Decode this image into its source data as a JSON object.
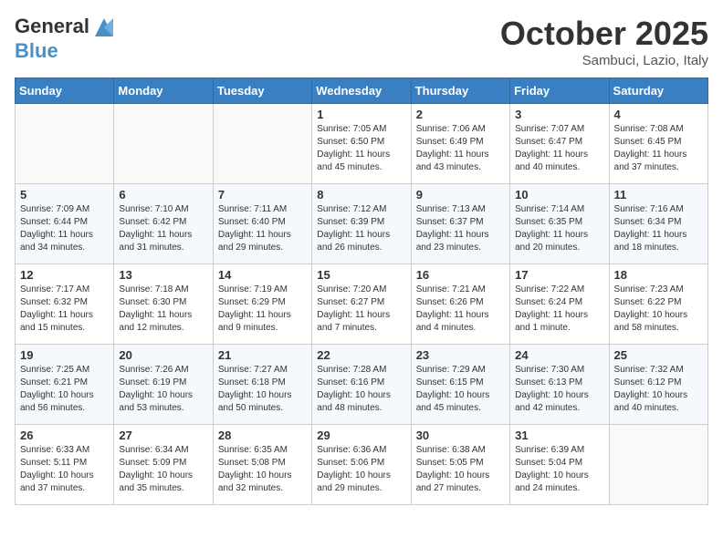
{
  "header": {
    "logo_line1": "General",
    "logo_line2": "Blue",
    "month": "October 2025",
    "location": "Sambuci, Lazio, Italy"
  },
  "weekdays": [
    "Sunday",
    "Monday",
    "Tuesday",
    "Wednesday",
    "Thursday",
    "Friday",
    "Saturday"
  ],
  "weeks": [
    [
      {
        "day": "",
        "info": ""
      },
      {
        "day": "",
        "info": ""
      },
      {
        "day": "",
        "info": ""
      },
      {
        "day": "1",
        "info": "Sunrise: 7:05 AM\nSunset: 6:50 PM\nDaylight: 11 hours\nand 45 minutes."
      },
      {
        "day": "2",
        "info": "Sunrise: 7:06 AM\nSunset: 6:49 PM\nDaylight: 11 hours\nand 43 minutes."
      },
      {
        "day": "3",
        "info": "Sunrise: 7:07 AM\nSunset: 6:47 PM\nDaylight: 11 hours\nand 40 minutes."
      },
      {
        "day": "4",
        "info": "Sunrise: 7:08 AM\nSunset: 6:45 PM\nDaylight: 11 hours\nand 37 minutes."
      }
    ],
    [
      {
        "day": "5",
        "info": "Sunrise: 7:09 AM\nSunset: 6:44 PM\nDaylight: 11 hours\nand 34 minutes."
      },
      {
        "day": "6",
        "info": "Sunrise: 7:10 AM\nSunset: 6:42 PM\nDaylight: 11 hours\nand 31 minutes."
      },
      {
        "day": "7",
        "info": "Sunrise: 7:11 AM\nSunset: 6:40 PM\nDaylight: 11 hours\nand 29 minutes."
      },
      {
        "day": "8",
        "info": "Sunrise: 7:12 AM\nSunset: 6:39 PM\nDaylight: 11 hours\nand 26 minutes."
      },
      {
        "day": "9",
        "info": "Sunrise: 7:13 AM\nSunset: 6:37 PM\nDaylight: 11 hours\nand 23 minutes."
      },
      {
        "day": "10",
        "info": "Sunrise: 7:14 AM\nSunset: 6:35 PM\nDaylight: 11 hours\nand 20 minutes."
      },
      {
        "day": "11",
        "info": "Sunrise: 7:16 AM\nSunset: 6:34 PM\nDaylight: 11 hours\nand 18 minutes."
      }
    ],
    [
      {
        "day": "12",
        "info": "Sunrise: 7:17 AM\nSunset: 6:32 PM\nDaylight: 11 hours\nand 15 minutes."
      },
      {
        "day": "13",
        "info": "Sunrise: 7:18 AM\nSunset: 6:30 PM\nDaylight: 11 hours\nand 12 minutes."
      },
      {
        "day": "14",
        "info": "Sunrise: 7:19 AM\nSunset: 6:29 PM\nDaylight: 11 hours\nand 9 minutes."
      },
      {
        "day": "15",
        "info": "Sunrise: 7:20 AM\nSunset: 6:27 PM\nDaylight: 11 hours\nand 7 minutes."
      },
      {
        "day": "16",
        "info": "Sunrise: 7:21 AM\nSunset: 6:26 PM\nDaylight: 11 hours\nand 4 minutes."
      },
      {
        "day": "17",
        "info": "Sunrise: 7:22 AM\nSunset: 6:24 PM\nDaylight: 11 hours\nand 1 minute."
      },
      {
        "day": "18",
        "info": "Sunrise: 7:23 AM\nSunset: 6:22 PM\nDaylight: 10 hours\nand 58 minutes."
      }
    ],
    [
      {
        "day": "19",
        "info": "Sunrise: 7:25 AM\nSunset: 6:21 PM\nDaylight: 10 hours\nand 56 minutes."
      },
      {
        "day": "20",
        "info": "Sunrise: 7:26 AM\nSunset: 6:19 PM\nDaylight: 10 hours\nand 53 minutes."
      },
      {
        "day": "21",
        "info": "Sunrise: 7:27 AM\nSunset: 6:18 PM\nDaylight: 10 hours\nand 50 minutes."
      },
      {
        "day": "22",
        "info": "Sunrise: 7:28 AM\nSunset: 6:16 PM\nDaylight: 10 hours\nand 48 minutes."
      },
      {
        "day": "23",
        "info": "Sunrise: 7:29 AM\nSunset: 6:15 PM\nDaylight: 10 hours\nand 45 minutes."
      },
      {
        "day": "24",
        "info": "Sunrise: 7:30 AM\nSunset: 6:13 PM\nDaylight: 10 hours\nand 42 minutes."
      },
      {
        "day": "25",
        "info": "Sunrise: 7:32 AM\nSunset: 6:12 PM\nDaylight: 10 hours\nand 40 minutes."
      }
    ],
    [
      {
        "day": "26",
        "info": "Sunrise: 6:33 AM\nSunset: 5:11 PM\nDaylight: 10 hours\nand 37 minutes."
      },
      {
        "day": "27",
        "info": "Sunrise: 6:34 AM\nSunset: 5:09 PM\nDaylight: 10 hours\nand 35 minutes."
      },
      {
        "day": "28",
        "info": "Sunrise: 6:35 AM\nSunset: 5:08 PM\nDaylight: 10 hours\nand 32 minutes."
      },
      {
        "day": "29",
        "info": "Sunrise: 6:36 AM\nSunset: 5:06 PM\nDaylight: 10 hours\nand 29 minutes."
      },
      {
        "day": "30",
        "info": "Sunrise: 6:38 AM\nSunset: 5:05 PM\nDaylight: 10 hours\nand 27 minutes."
      },
      {
        "day": "31",
        "info": "Sunrise: 6:39 AM\nSunset: 5:04 PM\nDaylight: 10 hours\nand 24 minutes."
      },
      {
        "day": "",
        "info": ""
      }
    ]
  ]
}
